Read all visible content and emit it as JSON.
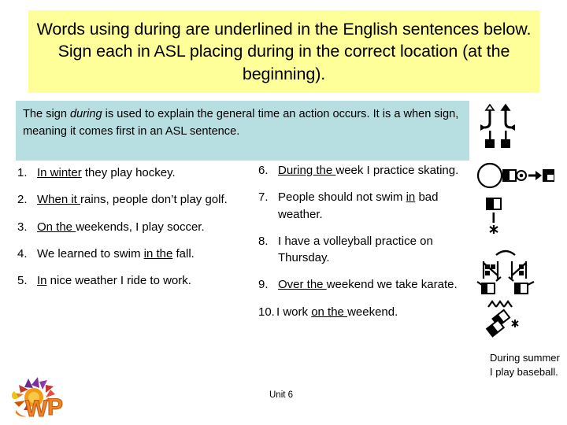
{
  "slide": {
    "title": "Words using during are underlined in the English sentences below.  Sign each in ASL placing during in the correct location (at the beginning).",
    "title_bg_color": "#ffff99",
    "info_bg_color": "#b7dee0",
    "info_box": {
      "part1": "The sign ",
      "italic1": "during",
      "part2": " is used to explain the general time an action occurs.  It is a ",
      "part3": "when",
      "part4": " sign, meaning it comes first in an ASL sentence."
    },
    "unit_label": "Unit 6",
    "caption": "During summer I play baseball.",
    "logo_text": "WP"
  },
  "sentences": {
    "left": [
      {
        "number": "1.",
        "underlined": "In winter",
        "rest": " they play hockey.",
        "lead": ""
      },
      {
        "number": "2.",
        "underlined": "When it ",
        "rest": "rains, people don’t play golf.",
        "lead": ""
      },
      {
        "number": "3.",
        "underlined": "On the ",
        "rest": "weekends, I play soccer.",
        "lead": ""
      },
      {
        "number": "4.",
        "underlined": "in the",
        "rest": " fall.",
        "lead": "We learned to swim "
      },
      {
        "number": "5.",
        "underlined": "In",
        "rest": " nice weather I ride to work.",
        "lead": ""
      }
    ],
    "right": [
      {
        "number": "6.",
        "underlined": "During the ",
        "rest": "week I practice skating.",
        "lead": ""
      },
      {
        "number": "7.",
        "underlined": "in",
        "rest": " bad weather.",
        "lead": "People should not swim "
      },
      {
        "number": "8.",
        "underlined": "",
        "rest": "I have a volleyball practice on Thursday.",
        "lead": ""
      },
      {
        "number": "9.",
        "underlined": "Over the ",
        "rest": "weekend we take karate.",
        "lead": ""
      },
      {
        "number": "10.",
        "underlined": "on the ",
        "rest": "weekend.",
        "lead": "I work "
      }
    ]
  },
  "signwriting": {
    "glyph_1": "during-sign-two-hands-up",
    "glyph_2": "head-hand-arrow-sign",
    "glyph_3": "flat-hand-contact-star-sign",
    "glyph_4": "two-hands-crossed-movement-sign",
    "glyph_5": "summer-sign-hand-arrows"
  }
}
